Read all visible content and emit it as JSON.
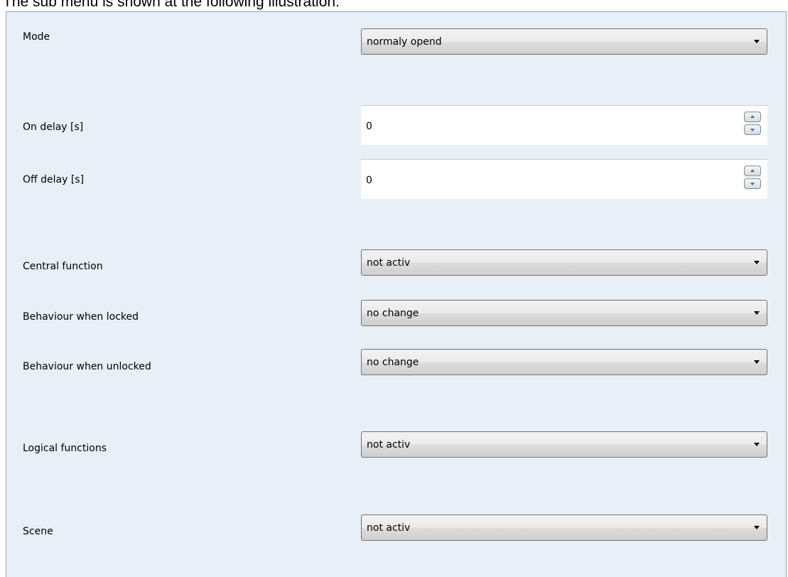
{
  "caption": "The sub menu is shown at the following illustration:",
  "params": {
    "mode": {
      "label": "Mode",
      "value": "normaly opend"
    },
    "on_delay": {
      "label": "On delay [s]",
      "value": "0"
    },
    "off_delay": {
      "label": "Off delay [s]",
      "value": "0"
    },
    "central_function": {
      "label": "Central function",
      "value": "not activ"
    },
    "behaviour_locked": {
      "label": "Behaviour when locked",
      "value": "no change"
    },
    "behaviour_unlocked": {
      "label": "Behaviour when unlocked",
      "value": "no change"
    },
    "logical_functions": {
      "label": "Logical functions",
      "value": "not activ"
    },
    "scene": {
      "label": "Scene",
      "value": "not activ"
    }
  },
  "icons": {
    "dropdown": "chevron-down-icon",
    "spin_up": "arrow-up-icon",
    "spin_down": "arrow-down-icon"
  },
  "colors": {
    "panel_background": "#e8eff7",
    "panel_border": "#8fa6c2",
    "spin_arrow": "#3c6fb0"
  }
}
